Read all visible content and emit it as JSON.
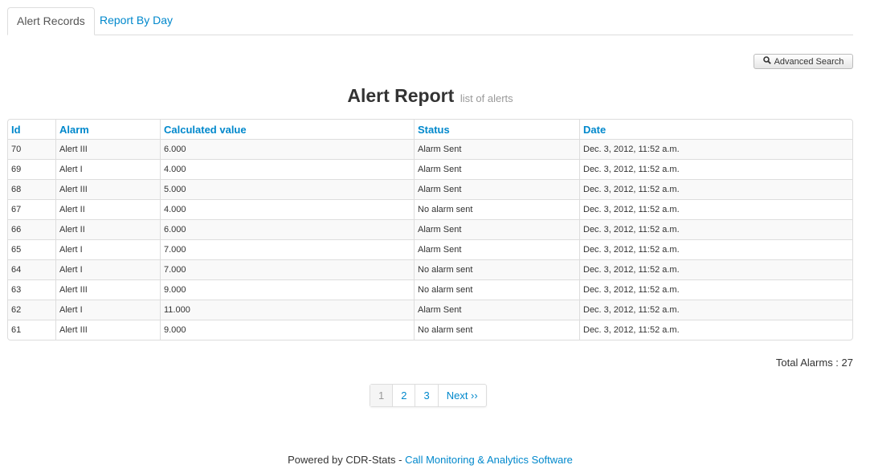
{
  "tabs": [
    {
      "label": "Alert Records",
      "active": true
    },
    {
      "label": "Report By Day",
      "active": false
    }
  ],
  "advanced_search": {
    "label": "Advanced Search",
    "icon": "search-icon"
  },
  "report": {
    "title": "Alert Report",
    "subtitle": "list of alerts"
  },
  "table": {
    "headers": [
      "Id",
      "Alarm",
      "Calculated value",
      "Status",
      "Date"
    ],
    "rows": [
      {
        "id": "70",
        "alarm": "Alert III",
        "value": "6.000",
        "status": "Alarm Sent",
        "date": "Dec. 3, 2012, 11:52 a.m."
      },
      {
        "id": "69",
        "alarm": "Alert I",
        "value": "4.000",
        "status": "Alarm Sent",
        "date": "Dec. 3, 2012, 11:52 a.m."
      },
      {
        "id": "68",
        "alarm": "Alert III",
        "value": "5.000",
        "status": "Alarm Sent",
        "date": "Dec. 3, 2012, 11:52 a.m."
      },
      {
        "id": "67",
        "alarm": "Alert II",
        "value": "4.000",
        "status": "No alarm sent",
        "date": "Dec. 3, 2012, 11:52 a.m."
      },
      {
        "id": "66",
        "alarm": "Alert II",
        "value": "6.000",
        "status": "Alarm Sent",
        "date": "Dec. 3, 2012, 11:52 a.m."
      },
      {
        "id": "65",
        "alarm": "Alert I",
        "value": "7.000",
        "status": "Alarm Sent",
        "date": "Dec. 3, 2012, 11:52 a.m."
      },
      {
        "id": "64",
        "alarm": "Alert I",
        "value": "7.000",
        "status": "No alarm sent",
        "date": "Dec. 3, 2012, 11:52 a.m."
      },
      {
        "id": "63",
        "alarm": "Alert III",
        "value": "9.000",
        "status": "No alarm sent",
        "date": "Dec. 3, 2012, 11:52 a.m."
      },
      {
        "id": "62",
        "alarm": "Alert I",
        "value": "11.000",
        "status": "Alarm Sent",
        "date": "Dec. 3, 2012, 11:52 a.m."
      },
      {
        "id": "61",
        "alarm": "Alert III",
        "value": "9.000",
        "status": "No alarm sent",
        "date": "Dec. 3, 2012, 11:52 a.m."
      }
    ]
  },
  "total": {
    "text": "Total Alarms : 27"
  },
  "pagination": {
    "pages": [
      "1",
      "2",
      "3"
    ],
    "current": "1",
    "next_label": "Next ››"
  },
  "footer": {
    "prefix": "Powered by CDR-Stats - ",
    "link": "Call Monitoring & Analytics Software"
  },
  "colors": {
    "link": "#0088cc",
    "text": "#333333",
    "stripe": "#f9f9f9",
    "border": "#dddddd"
  }
}
